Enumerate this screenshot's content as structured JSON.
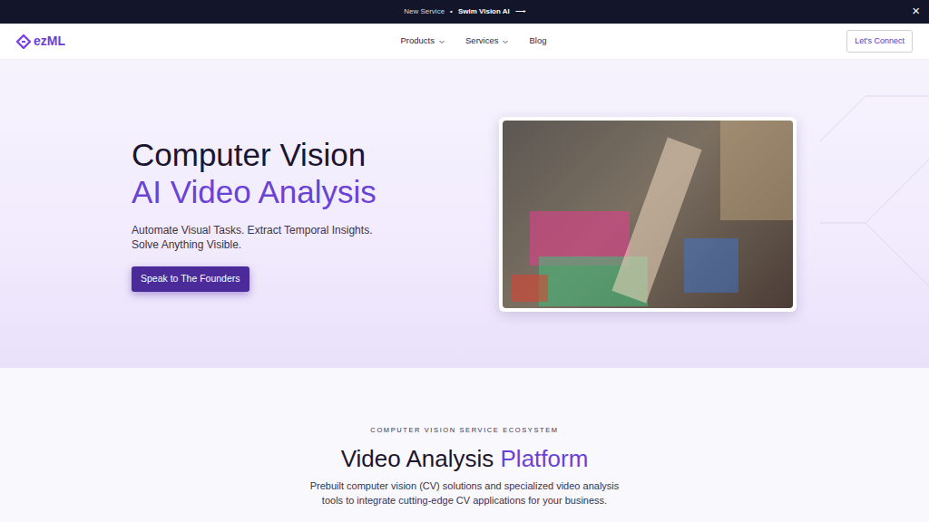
{
  "banner": {
    "label": "New Service",
    "separator": "•",
    "link": "Swim Vision AI",
    "arrow": "⟶",
    "close": "×"
  },
  "nav": {
    "logo": "ezML",
    "items": [
      {
        "label": "Products",
        "kind": "dropdown"
      },
      {
        "label": "Services",
        "kind": "dropdown"
      },
      {
        "label": "Blog",
        "kind": "link"
      }
    ],
    "cta": "Let's Connect"
  },
  "hero": {
    "title": "Computer Vision",
    "title_accent": "AI Video Analysis",
    "subtitle_lines": [
      "Automate Visual Tasks. Extract Temporal Insights.",
      "Solve Anything Visible."
    ],
    "button": "Speak to The Founders"
  },
  "section": {
    "eyebrow": "COMPUTER VISION SERVICE ECOSYSTEM",
    "title": "Video Analysis",
    "title_accent": "Platform",
    "description_lines": [
      "Prebuilt computer vision (CV) solutions and specialized video analysis",
      "tools to integrate cutting-edge CV applications for your business."
    ]
  }
}
